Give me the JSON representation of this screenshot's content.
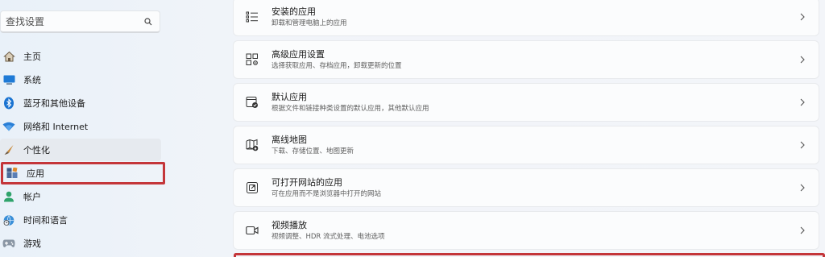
{
  "search": {
    "placeholder": "查找设置"
  },
  "sidebar": {
    "items": [
      {
        "label": "主页",
        "icon": "home-icon"
      },
      {
        "label": "系统",
        "icon": "system-icon"
      },
      {
        "label": "蓝牙和其他设备",
        "icon": "bluetooth-icon"
      },
      {
        "label": "网络和 Internet",
        "icon": "wifi-icon"
      },
      {
        "label": "个性化",
        "icon": "brush-icon"
      },
      {
        "label": "应用",
        "icon": "apps-icon"
      },
      {
        "label": "帐户",
        "icon": "account-icon"
      },
      {
        "label": "时间和语言",
        "icon": "globe-clock-icon"
      },
      {
        "label": "游戏",
        "icon": "gamepad-icon"
      }
    ]
  },
  "main": {
    "cards": [
      {
        "title": "安装的应用",
        "subtitle": "卸载和管理电脑上的应用",
        "icon": "list-icon"
      },
      {
        "title": "高级应用设置",
        "subtitle": "选择获取应用、存档应用，卸载更新的位置",
        "icon": "app-settings-icon"
      },
      {
        "title": "默认应用",
        "subtitle": "根据文件和链接种类设置的默认应用，其他默认应用",
        "icon": "default-apps-icon"
      },
      {
        "title": "离线地图",
        "subtitle": "下载、存储位置、地图更新",
        "icon": "map-icon"
      },
      {
        "title": "可打开网站的应用",
        "subtitle": "可在应用而不是浏览器中打开的网站",
        "icon": "open-link-icon"
      },
      {
        "title": "视频播放",
        "subtitle": "视频调整、HDR 流式处理、电池选项",
        "icon": "video-icon"
      }
    ]
  },
  "colors": {
    "highlight": "#c4363a",
    "accent": "#0067c0"
  }
}
